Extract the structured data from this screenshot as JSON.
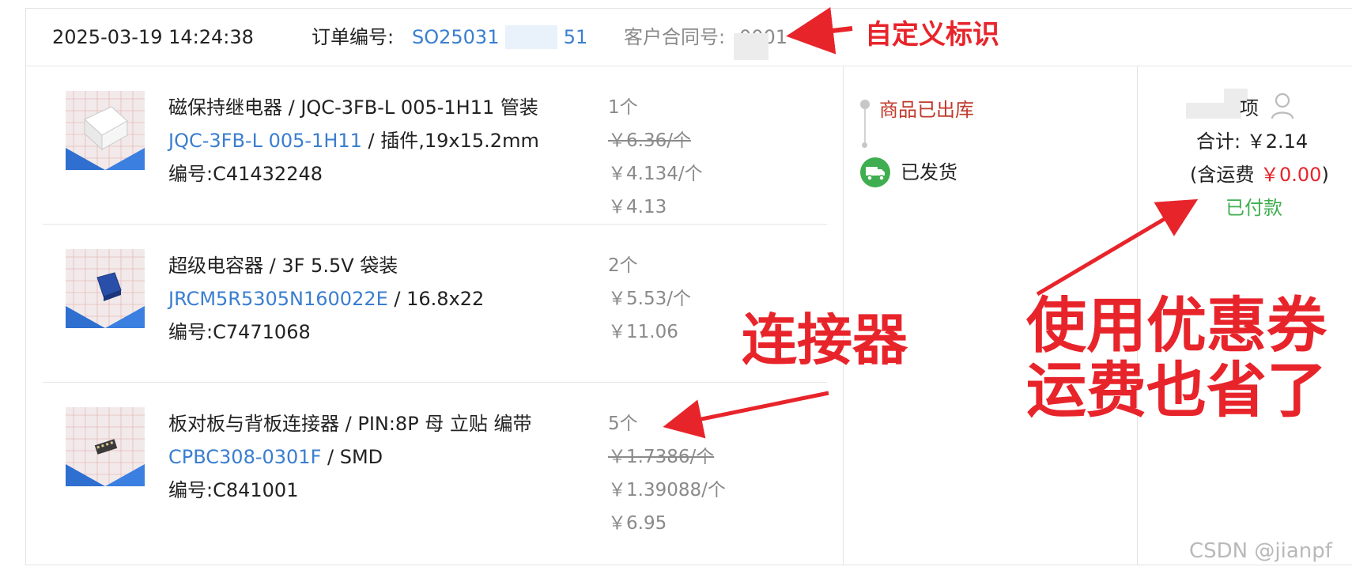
{
  "order": {
    "datetime": "2025-03-19 14:24:38",
    "order_no_label": "订单编号:",
    "order_no_prefix": "SO25031",
    "order_no_suffix": "51",
    "contract_label": "客户合同号:",
    "contract_value": "0001"
  },
  "items": [
    {
      "title": "磁保持继电器 / JQC-3FB-L 005-1H11 管装",
      "model_link": "JQC-3FB-L 005-1H11",
      "model_suffix": " / 插件,19x15.2mm",
      "code": "编号:C41432248",
      "qty": "1个",
      "orig_price": "￥6.36/个",
      "unit_price": "￥4.134/个",
      "subtotal": "￥4.13",
      "thumb_icon": "relay-product-thumbnail"
    },
    {
      "title": "超级电容器 / 3F 5.5V 袋装",
      "model_link": "JRCM5R5305N160022E",
      "model_suffix": " / 16.8x22",
      "code": "编号:C7471068",
      "qty": "2个",
      "unit_price": "￥5.53/个",
      "subtotal": "￥11.06",
      "thumb_icon": "supercapacitor-product-thumbnail"
    },
    {
      "title": "板对板与背板连接器 / PIN:8P 母 立贴 编带",
      "model_link": "CPBC308-0301F",
      "model_suffix": " / SMD",
      "code": "编号:C841001",
      "qty": "5个",
      "orig_price": "￥1.7386/个",
      "unit_price": "￥1.39088/个",
      "subtotal": "￥6.95",
      "thumb_icon": "connector-product-thumbnail"
    }
  ],
  "logistics": {
    "step1": "商品已出库",
    "step2": "已发货",
    "truck_icon": "delivery-truck-icon"
  },
  "summary": {
    "user_suffix": "项",
    "user_icon": "user-icon",
    "total_label": "合计:",
    "total_value": "￥2.14",
    "shipping_open": "(含运费 ",
    "shipping_value": "￥0.00",
    "shipping_close": ")",
    "pay_status": "已付款"
  },
  "annotations": {
    "custom_id": "自定义标识",
    "connector": "连接器",
    "coupon_line1": "使用优惠券",
    "coupon_line2": "运费也省了"
  },
  "watermark": "CSDN @jianpf",
  "colors": {
    "link_blue": "#3a7ed0",
    "annotation_red": "#e8242b",
    "status_red": "#c0392b",
    "paid_green": "#3fae50",
    "shipping_red": "#e8242b"
  }
}
